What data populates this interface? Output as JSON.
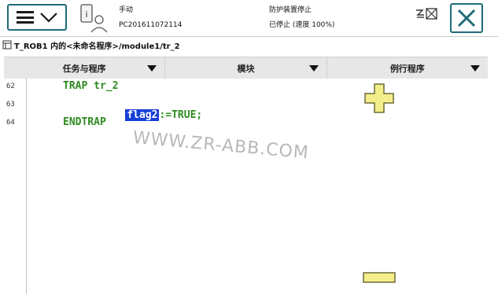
{
  "status": {
    "mode": "手动",
    "controller": "PC201611072114",
    "safety": "防护装置停止",
    "state": "已停止 (速度 100%)"
  },
  "path": "T_ROB1 内的<未命名程序>/module1/tr_2",
  "tabs": [
    {
      "label": "任务与程序"
    },
    {
      "label": "模块"
    },
    {
      "label": "例行程序"
    }
  ],
  "code": {
    "lines": [
      {
        "num": "62",
        "text": "TRAP tr_2"
      },
      {
        "num": "63",
        "selected": "flag2",
        "rest": ":=TRUE;"
      },
      {
        "num": "64",
        "text": "ENDTRAP"
      }
    ]
  },
  "watermark": "WWW.ZR-ABB.COM",
  "colors": {
    "accent": "#1f6b78",
    "keyword": "#2e8b20",
    "selection": "#1840d8",
    "zoom_button": "#f4ee8a"
  },
  "icons": {
    "menu": "hamburger-menu-icon",
    "robot": "robot-status-icon",
    "close": "close-icon",
    "network": "network-status-icon",
    "zoom_in": "plus-icon",
    "zoom_out": "minus-icon"
  }
}
